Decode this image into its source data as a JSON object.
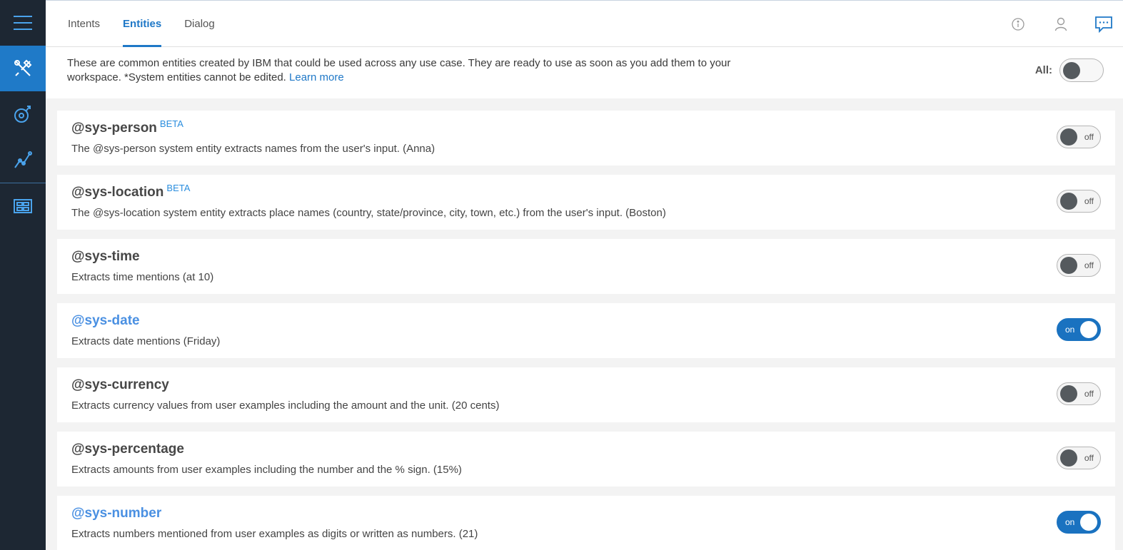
{
  "sidebar": {
    "items": [
      {
        "icon": "hamburger-menu-icon"
      },
      {
        "icon": "build-tools-icon",
        "active": true
      },
      {
        "icon": "improve-icon"
      },
      {
        "icon": "analytics-line-icon"
      },
      {
        "icon": "workspace-grid-icon"
      }
    ]
  },
  "header": {
    "tabs": [
      {
        "label": "Intents",
        "active": false
      },
      {
        "label": "Entities",
        "active": true
      },
      {
        "label": "Dialog",
        "active": false
      }
    ],
    "icons": [
      "info-icon",
      "user-icon",
      "chat-icon"
    ]
  },
  "intro": {
    "text": "These are common entities created by IBM that could be used across any use case. They are ready to use as soon as you add them to your workspace. *System entities cannot be edited.",
    "link": "Learn more",
    "all_label": "All:"
  },
  "entities": [
    {
      "name": "@sys-person",
      "beta": "BETA",
      "desc": "The @sys-person system entity extracts names from the user's input. (Anna)",
      "state": "off"
    },
    {
      "name": "@sys-location",
      "beta": "BETA",
      "desc": "The @sys-location system entity extracts place names (country, state/province, city, town, etc.) from the user's input. (Boston)",
      "state": "off"
    },
    {
      "name": "@sys-time",
      "beta": "",
      "desc": "Extracts time mentions (at 10)",
      "state": "off"
    },
    {
      "name": "@sys-date",
      "beta": "",
      "desc": "Extracts date mentions (Friday)",
      "state": "on"
    },
    {
      "name": "@sys-currency",
      "beta": "",
      "desc": "Extracts currency values from user examples including the amount and the unit. (20 cents)",
      "state": "off"
    },
    {
      "name": "@sys-percentage",
      "beta": "",
      "desc": "Extracts amounts from user examples including the number and the % sign. (15%)",
      "state": "off"
    },
    {
      "name": "@sys-number",
      "beta": "",
      "desc": "Extracts numbers mentioned from user examples as digits or written as numbers. (21)",
      "state": "on"
    }
  ],
  "colors": {
    "accent": "#1f78c7",
    "rail": "#1d2733",
    "on_name": "#4a90e2"
  }
}
